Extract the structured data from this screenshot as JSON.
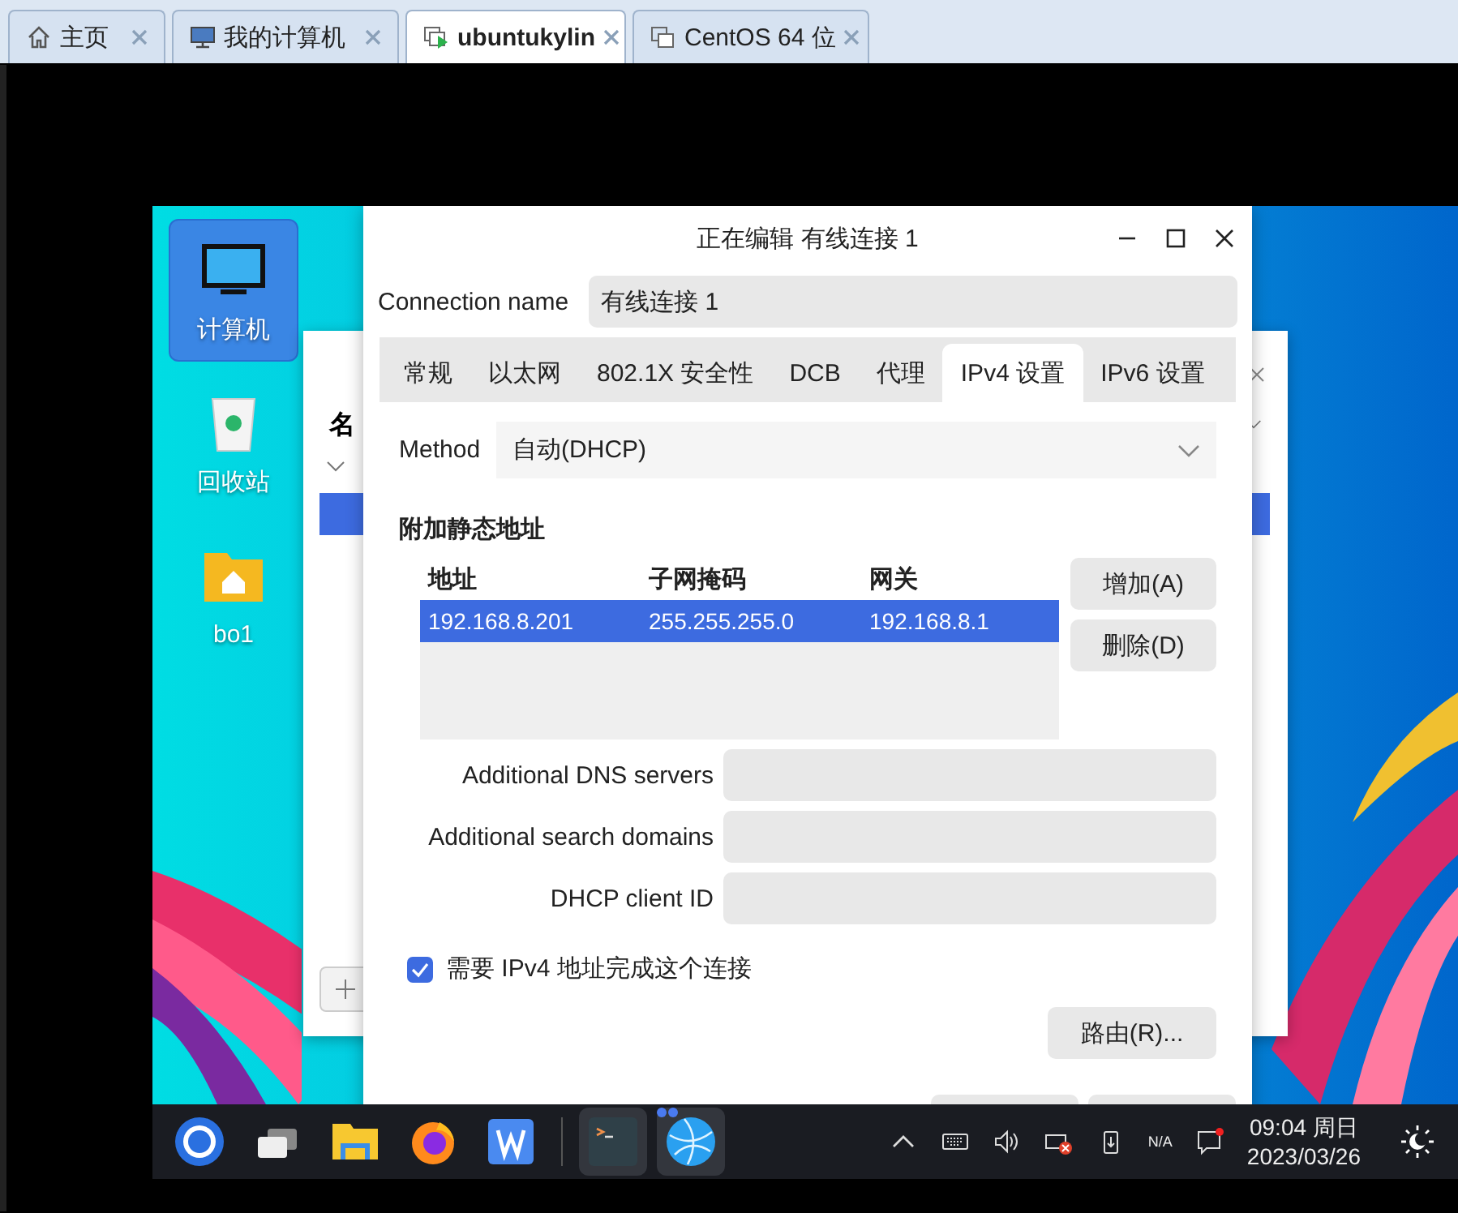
{
  "host_tabs": [
    {
      "label": "主页",
      "kind": "home",
      "selected": false
    },
    {
      "label": "我的计算机",
      "kind": "computer",
      "selected": false
    },
    {
      "label": "ubuntukylin",
      "kind": "vm-running",
      "selected": true
    },
    {
      "label": "CentOS 64 位",
      "kind": "vm",
      "selected": false
    }
  ],
  "desktop_icons": [
    {
      "label": "计算机",
      "kind": "computer",
      "selected": true
    },
    {
      "label": "回收站",
      "kind": "trash",
      "selected": false
    },
    {
      "label": "bo1",
      "kind": "folder",
      "selected": false
    }
  ],
  "background_window": {
    "header": "名"
  },
  "dialog": {
    "title": "正在编辑 有线连接 1",
    "connection_name": {
      "label": "Connection name",
      "value": "有线连接 1"
    },
    "tabs": [
      {
        "label": "常规",
        "selected": false
      },
      {
        "label": "以太网",
        "selected": false
      },
      {
        "label": "802.1X 安全性",
        "selected": false
      },
      {
        "label": "DCB",
        "selected": false
      },
      {
        "label": "代理",
        "selected": false
      },
      {
        "label": "IPv4 设置",
        "selected": true
      },
      {
        "label": "IPv6 设置",
        "selected": false
      }
    ],
    "method": {
      "label": "Method",
      "value": "自动(DHCP)"
    },
    "static_addresses": {
      "title": "附加静态地址",
      "columns": [
        "地址",
        "子网掩码",
        "网关"
      ],
      "rows": [
        {
          "cells": [
            "192.168.8.201",
            "255.255.255.0",
            "192.168.8.1"
          ],
          "selected": true
        }
      ],
      "buttons": [
        "增加(A)",
        "删除(D)"
      ]
    },
    "fields": [
      {
        "label": "Additional DNS servers"
      },
      {
        "label": "Additional search domains"
      },
      {
        "label": "DHCP client ID"
      }
    ],
    "require_ipv4": {
      "label": "需要 IPv4 地址完成这个连接",
      "checked": true
    },
    "routes_button": "路由(R)..."
  },
  "taskbar": {
    "apps": [
      {
        "kind": "start",
        "open": false
      },
      {
        "kind": "windows",
        "open": false
      },
      {
        "kind": "files",
        "open": false
      },
      {
        "kind": "firefox",
        "open": false
      },
      {
        "kind": "wps",
        "open": false
      },
      {
        "kind": "terminal",
        "open": true
      },
      {
        "kind": "browser",
        "open": true
      }
    ],
    "network_status": "N/A",
    "time": "09:04 周日",
    "date": "2023/03/26"
  }
}
